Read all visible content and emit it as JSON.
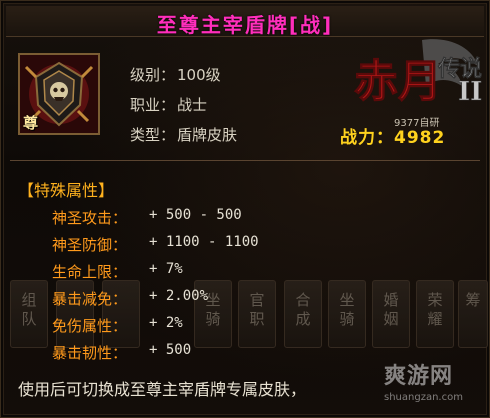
{
  "title": "至尊主宰盾牌[战]",
  "item": {
    "badge": "尊",
    "fields": [
      {
        "label": "级别：",
        "value": "100级"
      },
      {
        "label": "职业：",
        "value": "战士"
      },
      {
        "label": "类型：",
        "value": "盾牌皮肤"
      }
    ]
  },
  "logo": {
    "name": "赤月传说II",
    "sub": "9377自研"
  },
  "power": {
    "label": "战力：",
    "value": "4982"
  },
  "special": {
    "heading": "【特殊属性】",
    "rows": [
      {
        "key": "神圣攻击：",
        "value": "+ 500 - 500"
      },
      {
        "key": "神圣防御：",
        "value": "+ 1100 - 1100"
      },
      {
        "key": "生命上限：",
        "value": "+ 7%"
      },
      {
        "key": "暴击减免：",
        "value": "+ 2.00%"
      },
      {
        "key": "免伤属性：",
        "value": "+ 2%"
      },
      {
        "key": "暴击韧性：",
        "value": "+ 500"
      }
    ]
  },
  "background_tiles": [
    "组队",
    "",
    "",
    "坐骑",
    "官职",
    "合成",
    "坐骑",
    "婚姻",
    "荣耀",
    "筹"
  ],
  "description": "使用后可切换成至尊主宰盾牌专属皮肤，",
  "watermark": {
    "text": "爽游网",
    "url": "shuangzan.com"
  },
  "colors": {
    "title": "#ff2ebc",
    "power": "#ffd21e",
    "attr_key": "#ff9a1c",
    "heading": "#ffb21e"
  }
}
